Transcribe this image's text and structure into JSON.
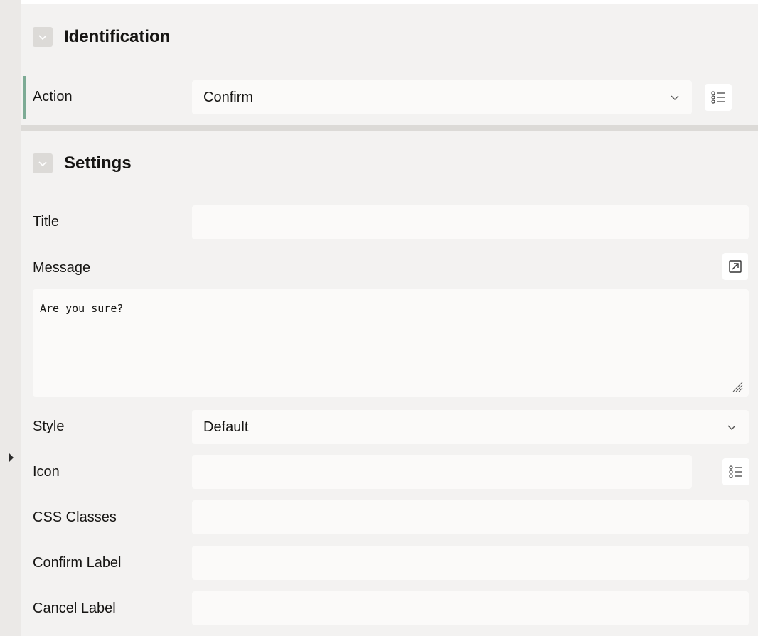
{
  "identification": {
    "title": "Identification",
    "action_label": "Action",
    "action_value": "Confirm"
  },
  "settings": {
    "title": "Settings",
    "title_label": "Title",
    "title_value": "",
    "message_label": "Message",
    "message_value": "Are you sure?",
    "style_label": "Style",
    "style_value": "Default",
    "icon_label": "Icon",
    "icon_value": "",
    "css_classes_label": "CSS Classes",
    "css_classes_value": "",
    "confirm_label_label": "Confirm Label",
    "confirm_label_value": "",
    "cancel_label_label": "Cancel Label",
    "cancel_label_value": ""
  },
  "icons": {
    "collapse": "chevron-down-icon",
    "list_picker": "list-icon",
    "expand": "expand-arrow-icon",
    "resize": "resize-grip-icon",
    "splitter": "caret-right-icon"
  },
  "colors": {
    "accent_bar": "#7dab95",
    "panel_bg": "#f3f2f1",
    "field_bg": "#fbfaf9"
  }
}
